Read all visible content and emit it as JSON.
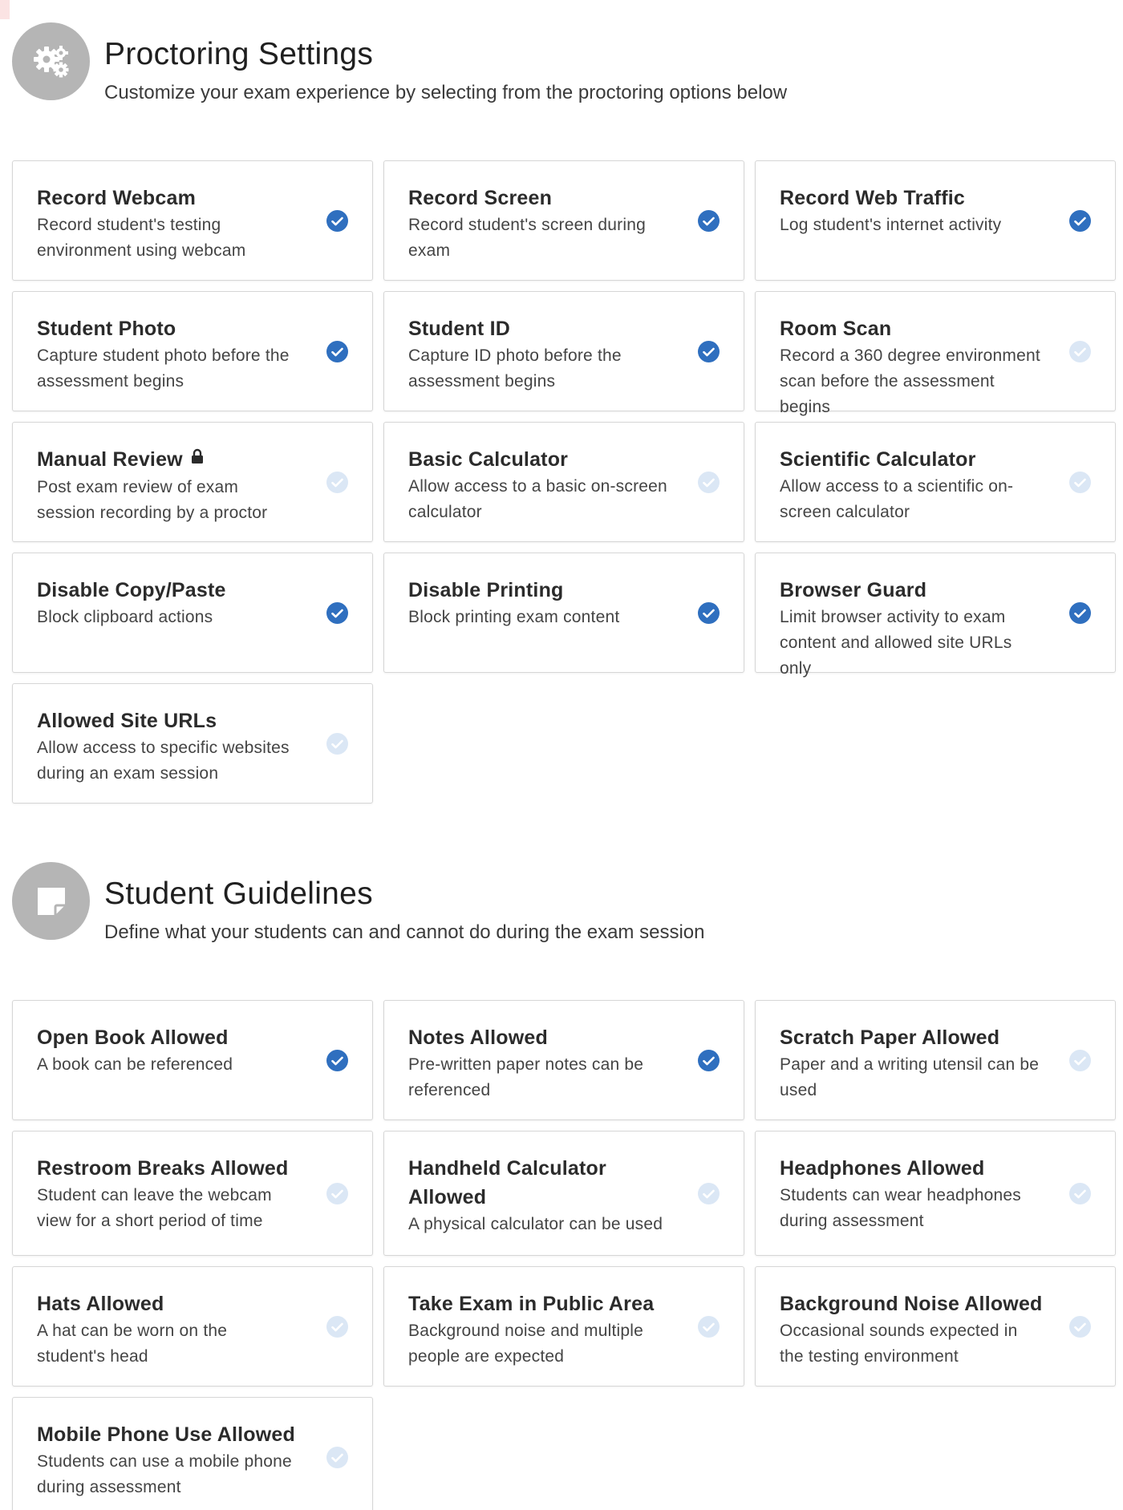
{
  "colors": {
    "accent": "#2f6fbf",
    "check_off": "#dbe7f5",
    "icon_bg": "#b5b5b5"
  },
  "proctoring": {
    "icon": "gears-icon",
    "title": "Proctoring Settings",
    "subtitle": "Customize your exam experience by selecting from the proctoring options below",
    "options": [
      {
        "title": "Record Webcam",
        "desc": "Record student's testing environment using webcam",
        "checked": true
      },
      {
        "title": "Record Screen",
        "desc": "Record student's screen during exam",
        "checked": true
      },
      {
        "title": "Record Web Traffic",
        "desc": "Log student's internet activity",
        "checked": true
      },
      {
        "title": "Student Photo",
        "desc": "Capture student photo before the assessment begins",
        "checked": true
      },
      {
        "title": "Student ID",
        "desc": "Capture ID photo before the assessment begins",
        "checked": true
      },
      {
        "title": "Room Scan",
        "desc": "Record a 360 degree environment scan before the assessment begins",
        "checked": false
      },
      {
        "title": "Manual Review",
        "desc": "Post exam review of exam session recording by a proctor",
        "checked": false,
        "locked": true
      },
      {
        "title": "Basic Calculator",
        "desc": "Allow access to a basic on-screen calculator",
        "checked": false
      },
      {
        "title": "Scientific Calculator",
        "desc": "Allow access to a scientific on-screen calculator",
        "checked": false
      },
      {
        "title": "Disable Copy/Paste",
        "desc": "Block clipboard actions",
        "checked": true
      },
      {
        "title": "Disable Printing",
        "desc": "Block printing exam content",
        "checked": true
      },
      {
        "title": "Browser Guard",
        "desc": "Limit browser activity to exam content and allowed site URLs only",
        "checked": true
      },
      {
        "title": "Allowed Site URLs",
        "desc": "Allow access to specific websites during an exam session",
        "checked": false
      }
    ]
  },
  "guidelines": {
    "icon": "sticky-note-icon",
    "title": "Student Guidelines",
    "subtitle": "Define what your students can and cannot do during the exam session",
    "options": [
      {
        "title": "Open Book Allowed",
        "desc": "A book can be referenced",
        "checked": true
      },
      {
        "title": "Notes Allowed",
        "desc": "Pre-written paper notes can be referenced",
        "checked": true
      },
      {
        "title": "Scratch Paper Allowed",
        "desc": "Paper and a writing utensil can be used",
        "checked": false
      },
      {
        "title": "Restroom Breaks Allowed",
        "desc": "Student can leave the webcam view for a short period of time",
        "checked": false
      },
      {
        "title": "Handheld Calculator Allowed",
        "desc": "A physical calculator can be used",
        "checked": false
      },
      {
        "title": "Headphones Allowed",
        "desc": "Students can wear headphones during assessment",
        "checked": false
      },
      {
        "title": "Hats Allowed",
        "desc": "A hat can be worn on the student's head",
        "checked": false
      },
      {
        "title": "Take Exam in Public Area",
        "desc": "Background noise and multiple people are expected",
        "checked": false
      },
      {
        "title": "Background Noise Allowed",
        "desc": "Occasional sounds expected in the testing environment",
        "checked": false
      },
      {
        "title": "Mobile Phone Use Allowed",
        "desc": "Students can use a mobile phone during assessment",
        "checked": false
      }
    ]
  }
}
